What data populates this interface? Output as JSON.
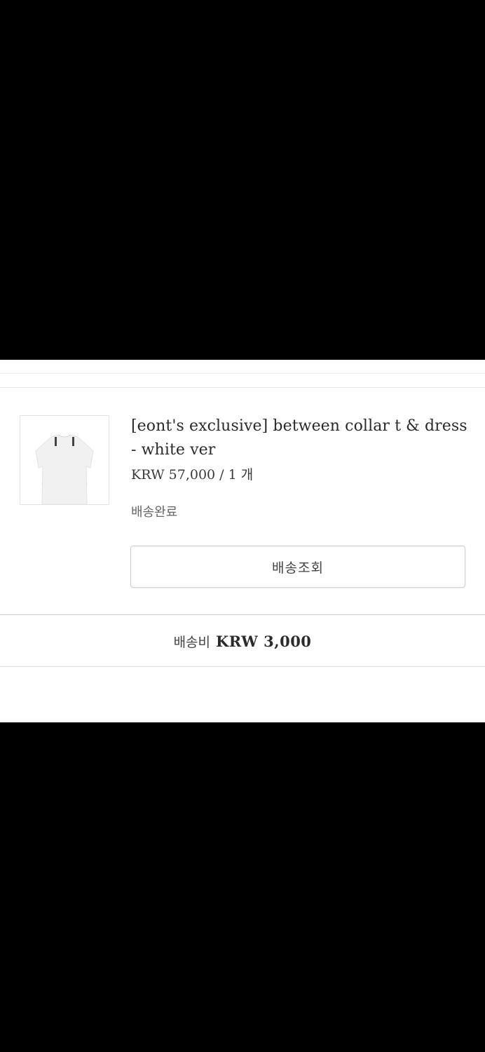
{
  "order_item": {
    "product_name": "[eont's exclusive] between collar t & dress - white ver",
    "price": "KRW 57,000",
    "quantity_separator": " / ",
    "quantity": "1 개",
    "status": "배송완료",
    "track_button_label": "배송조회",
    "thumbnail": "white-collar-tshirt-image"
  },
  "shipping": {
    "label": "배송비",
    "value": "KRW 3,000"
  }
}
